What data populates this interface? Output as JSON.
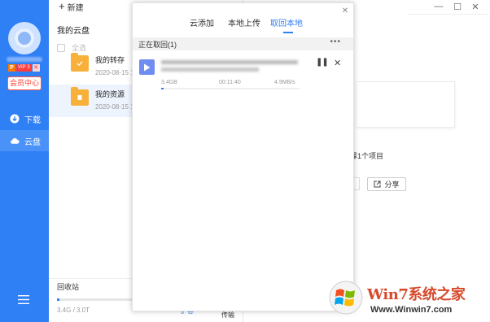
{
  "sidebar": {
    "vip_p": "P",
    "vip_label": "VIP 3",
    "vip_extra": "✕",
    "member_center": "会员中心",
    "nav": [
      {
        "label": "下载",
        "icon": "download-icon"
      },
      {
        "label": "云盘",
        "icon": "cloud-icon"
      }
    ],
    "menu_icon": "hamburger-menu-icon",
    "accent": "#2f7ff5"
  },
  "main": {
    "new_label": "新建",
    "panel_title": "我的云盘",
    "select_all": "全选",
    "files": [
      {
        "name": "我的转存",
        "date": "2020-08-15 1"
      },
      {
        "name": "我的资源",
        "date": "2020-08-15 1"
      }
    ],
    "recycle_bin": "回收站",
    "storage_text": "3.4G / 3.0T",
    "storage_fraction": 0.01,
    "expand_link": "扩容",
    "transfer_label": "传输"
  },
  "details": {
    "selected_info": "选择1个项目",
    "share_label": "分享"
  },
  "modal": {
    "tabs": [
      "云添加",
      "本地上传",
      "取回本地"
    ],
    "active_tab": 2,
    "section_title": "正在取回(1)",
    "more": "•••",
    "task": {
      "size": "3.4GB",
      "time_left": "00:11:40",
      "speed": "4.9MB/s",
      "progress": 0.01
    }
  },
  "watermark": {
    "title": "Win7系统之家",
    "url": "Www.Winwin7.com"
  }
}
